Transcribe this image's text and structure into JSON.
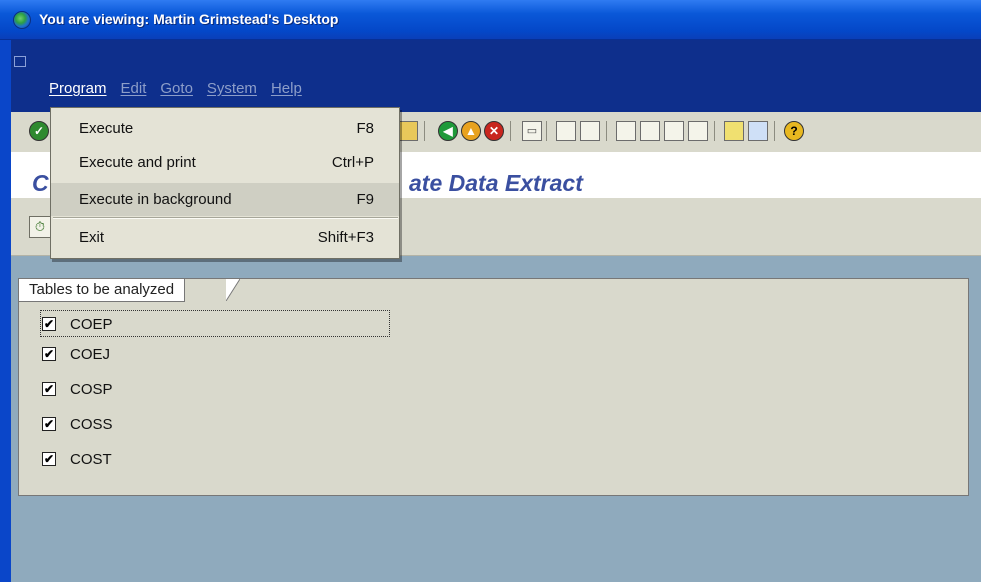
{
  "window": {
    "title": "You are viewing: Martin Grimstead's Desktop"
  },
  "menubar": {
    "items": [
      {
        "label": "Program",
        "active": true
      },
      {
        "label": "Edit",
        "active": false
      },
      {
        "label": "Goto",
        "active": false
      },
      {
        "label": "System",
        "active": false
      },
      {
        "label": "Help",
        "active": false
      }
    ]
  },
  "program_menu": {
    "items": [
      {
        "label": "Execute",
        "shortcut": "F8"
      },
      {
        "label": "Execute and print",
        "shortcut": "Ctrl+P"
      },
      {
        "label": "Execute in background",
        "shortcut": "F9",
        "highlighted": true
      },
      {
        "label": "Exit",
        "shortcut": "Shift+F3"
      }
    ]
  },
  "screen": {
    "title_left": "C",
    "title_right": "ate Data Extract"
  },
  "group": {
    "title": "Tables to be analyzed",
    "items": [
      {
        "label": "COEP",
        "checked": true,
        "focused": true
      },
      {
        "label": "COEJ",
        "checked": true
      },
      {
        "label": "COSP",
        "checked": true
      },
      {
        "label": "COSS",
        "checked": true
      },
      {
        "label": "COST",
        "checked": true
      }
    ]
  },
  "checkbox_glyph": "✔"
}
